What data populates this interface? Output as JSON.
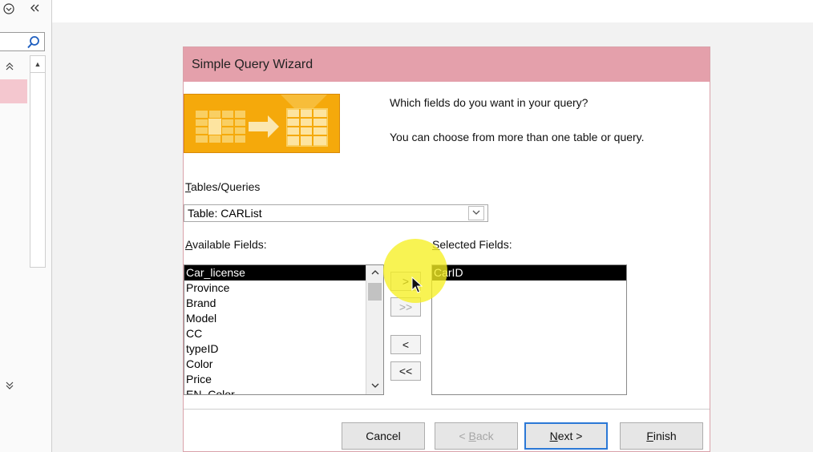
{
  "nav_pane": {
    "icons": [
      "chevron-circle-icon",
      "collapse-left-icon",
      "search-icon",
      "expand-up-icon",
      "expand-down-icon"
    ]
  },
  "dialog": {
    "title": "Simple Query Wizard",
    "question": "Which fields do you want in your query?",
    "hint": "You can choose from more than one table or query.",
    "tables_label": "Tables/Queries",
    "tables_label_mnemonic": "T",
    "tables_label_rest": "ables/Queries",
    "tables_selected": "Table: CARList",
    "available_label_mnemonic": "A",
    "available_label_rest": "vailable Fields:",
    "selected_label_mnemonic": "S",
    "selected_label_rest": "elected Fields:",
    "available_fields": [
      "Car_license",
      "Province",
      "Brand",
      "Model",
      "CC",
      "typeID",
      "Color",
      "Price",
      "EN_Color"
    ],
    "selected_fields": [
      "CarID"
    ],
    "move_buttons": {
      "add_one": ">",
      "add_all": ">>",
      "remove_one": "<",
      "remove_all": "<<"
    },
    "buttons": {
      "cancel": "Cancel",
      "back_pre": "< ",
      "back_mnemonic": "B",
      "back_rest": "ack",
      "next_mnemonic": "N",
      "next_rest": "ext >",
      "finish_mnemonic": "F",
      "finish_rest": "inish"
    },
    "colors": {
      "title_bar": "#e4a0ab",
      "wizard_image": "#f5a90b",
      "cursor_highlight": "#f6f023",
      "default_button_border": "#2b78d6"
    }
  }
}
